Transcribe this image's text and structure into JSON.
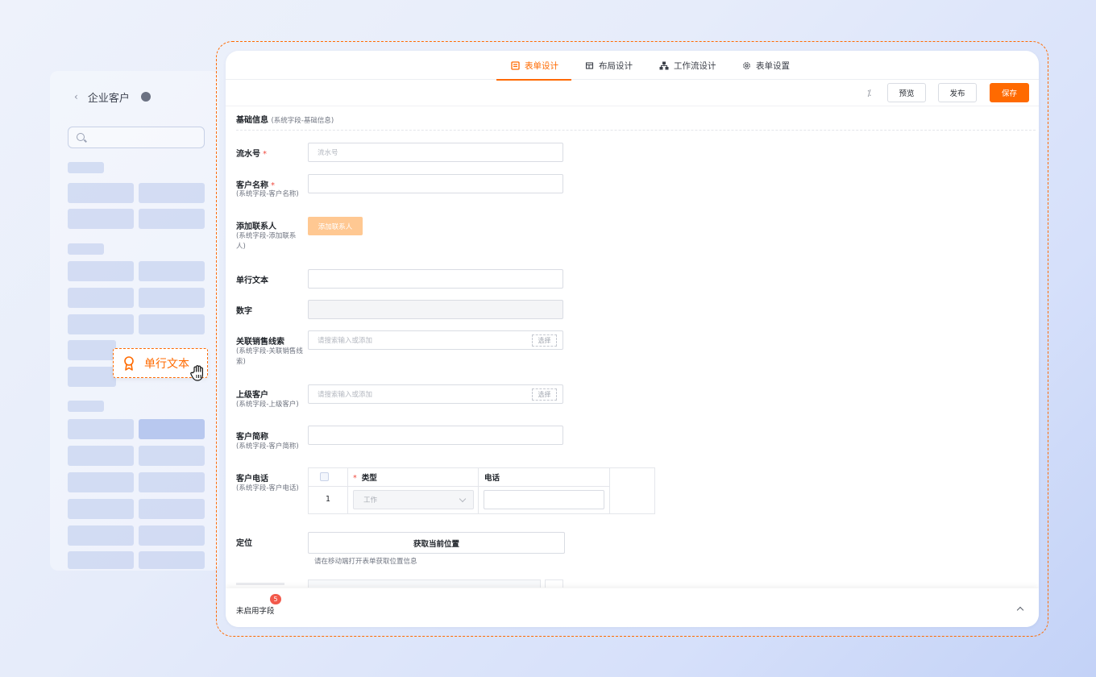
{
  "background": {
    "back_label": "‹",
    "title": "企业客户"
  },
  "drag_chip": {
    "label": "单行文本",
    "icon": "ribbon-icon"
  },
  "tabs": [
    {
      "label": "表单设计",
      "icon": "form-icon",
      "active": true
    },
    {
      "label": "布局设计",
      "icon": "layout-icon",
      "active": false
    },
    {
      "label": "工作流设计",
      "icon": "workflow-icon",
      "active": false
    },
    {
      "label": "表单设置",
      "icon": "gear-icon",
      "active": false
    }
  ],
  "toolbar": {
    "preview": "预览",
    "publish": "发布",
    "save": "保存"
  },
  "section": {
    "title": "基础信息",
    "subtitle": "(系统字段-基础信息)"
  },
  "fields": {
    "serial": {
      "label": "流水号",
      "required": "*",
      "placeholder": "流水号"
    },
    "customer_name": {
      "label": "客户名称",
      "required": "*",
      "sub": "(系统字段-客户名称)"
    },
    "add_contact": {
      "label": "添加联系人",
      "sub": "(系统字段-添加联系人)",
      "button": "添加联系人"
    },
    "single_text": {
      "label": "单行文本"
    },
    "number": {
      "label": "数字"
    },
    "sales_lead": {
      "label": "关联销售线索",
      "sub": "(系统字段-关联销售线索)",
      "placeholder": "请搜索输入或添加",
      "select": "选择"
    },
    "parent_customer": {
      "label": "上级客户",
      "sub": "(系统字段-上级客户)",
      "placeholder": "请搜索输入或添加",
      "select": "选择"
    },
    "short_name": {
      "label": "客户简称",
      "sub": "(系统字段-客户简称)"
    },
    "phone": {
      "label": "客户电话",
      "sub": "(系统字段-客户电话)",
      "col_type": "类型",
      "col_type_required": "*",
      "col_phone": "电话",
      "rows": [
        {
          "index": "1",
          "type": "工作"
        }
      ]
    },
    "location": {
      "label": "定位",
      "button": "获取当前位置",
      "hint": "请在移动端打开表单获取位置信息"
    }
  },
  "bottom_bar": {
    "label": "未启用字段",
    "badge": "5"
  },
  "colors": {
    "accent": "#ff6a00",
    "required": "#f04b3f"
  }
}
